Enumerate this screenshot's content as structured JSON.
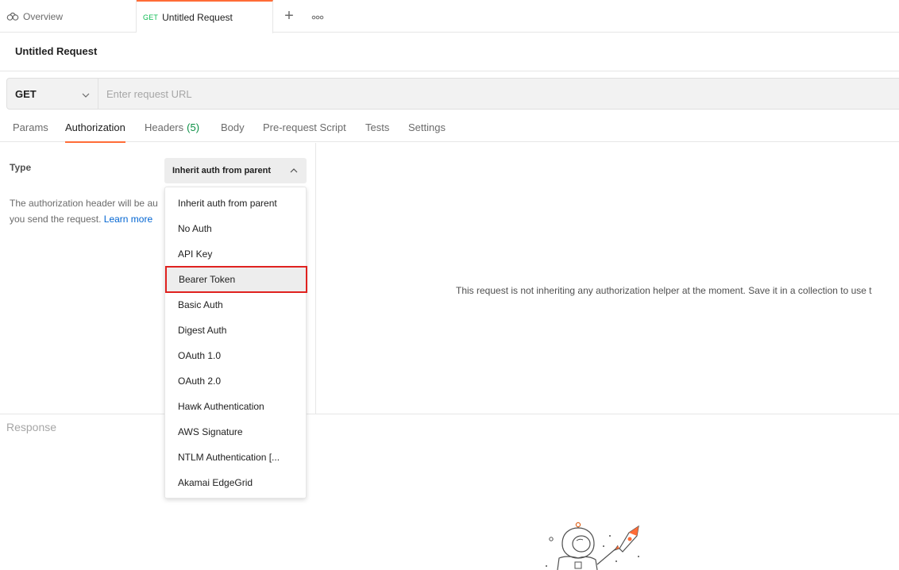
{
  "tabs": {
    "overview_label": "Overview",
    "request_method": "GET",
    "request_label": "Untitled Request",
    "add_label": "+"
  },
  "request": {
    "title": "Untitled Request",
    "method": "GET",
    "url_placeholder": "Enter request URL"
  },
  "subtabs": [
    {
      "label": "Params"
    },
    {
      "label": "Authorization"
    },
    {
      "label": "Headers",
      "count": "(5)"
    },
    {
      "label": "Body"
    },
    {
      "label": "Pre-request Script"
    },
    {
      "label": "Tests"
    },
    {
      "label": "Settings"
    }
  ],
  "auth": {
    "type_label": "Type",
    "selected_type": "Inherit auth from parent",
    "description": "The authorization header will be au",
    "description_line2": "you send the request.",
    "learn_more": "Learn more",
    "right_message": "This request is not inheriting any authorization helper at the moment. Save it in a collection to use t"
  },
  "dropdown": {
    "items": [
      "Inherit auth from parent",
      "No Auth",
      "API Key",
      "Bearer Token",
      "Basic Auth",
      "Digest Auth",
      "OAuth 1.0",
      "OAuth 2.0",
      "Hawk Authentication",
      "AWS Signature",
      "NTLM Authentication [...",
      "Akamai EdgeGrid"
    ],
    "highlighted": "Bearer Token"
  },
  "response": {
    "label": "Response"
  },
  "colors": {
    "accent": "#ff6c37",
    "method_get": "#0cbb52",
    "link": "#0265d2",
    "highlight_border": "#e0221f"
  }
}
